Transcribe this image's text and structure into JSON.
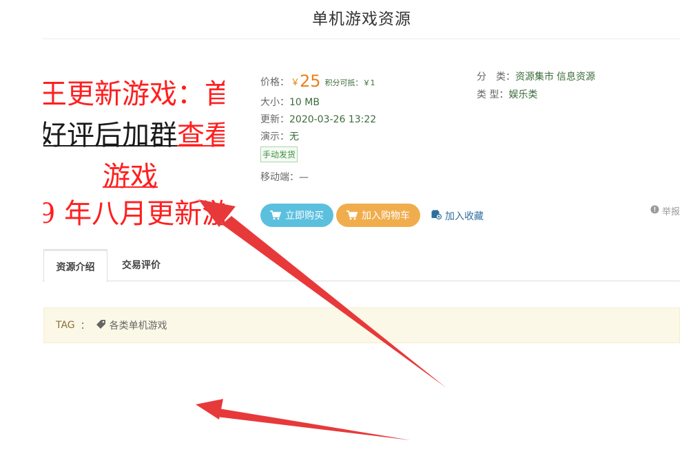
{
  "page": {
    "title": "单机游戏资源"
  },
  "promo_image": {
    "lines": [
      {
        "segments": [
          {
            "text": "王更新游戏：首",
            "style": "red"
          }
        ]
      },
      {
        "segments": [
          {
            "text": "好评后加群",
            "style": "black-underline"
          },
          {
            "text": "查看",
            "style": "red-underline"
          }
        ]
      },
      {
        "segments": [
          {
            "text": "游戏",
            "style": "red-underline"
          }
        ]
      },
      {
        "segments": [
          {
            "text": "9 年八月更新游",
            "style": "red"
          }
        ]
      }
    ]
  },
  "info": {
    "price_label": "价格：",
    "price_symbol": "￥",
    "price_value": "25",
    "points_text": "积分可抵：￥1",
    "size_label": "大小：",
    "size_value": "10 MB",
    "updated_label": "更新：",
    "updated_value": "2020-03-26 13:22",
    "demo_label": "演示：",
    "demo_value": "无",
    "delivery_badge": "手动发货",
    "mobile_label": "移动端：",
    "mobile_value": "—"
  },
  "meta": {
    "category_label": "分　类：",
    "category_links": [
      "资源集市",
      "信息资源"
    ],
    "type_label": "类 型：",
    "type_value": "娱乐类"
  },
  "actions": {
    "buy_label": "立即购买",
    "cart_label": "加入购物车",
    "favorite_label": "加入收藏",
    "report_label": "举报"
  },
  "tabs": [
    {
      "label": "资源介绍",
      "active": true
    },
    {
      "label": "交易评价",
      "active": false
    }
  ],
  "tagbar": {
    "label": "TAG",
    "colon": "：",
    "tags": [
      "各类单机游戏"
    ]
  },
  "colors": {
    "accent_green": "#3b6b3b",
    "price_orange": "#e8811a",
    "buy_button": "#5bc0de",
    "cart_button": "#f0ad4e",
    "arrow_red": "#e8393a",
    "tag_bg": "#fcf8e7"
  },
  "icons": {
    "buy": "cart-icon",
    "cart": "cart-icon",
    "favorite": "favorite-box-icon",
    "report": "exclamation-circle-icon",
    "tag": "tag-icon"
  }
}
